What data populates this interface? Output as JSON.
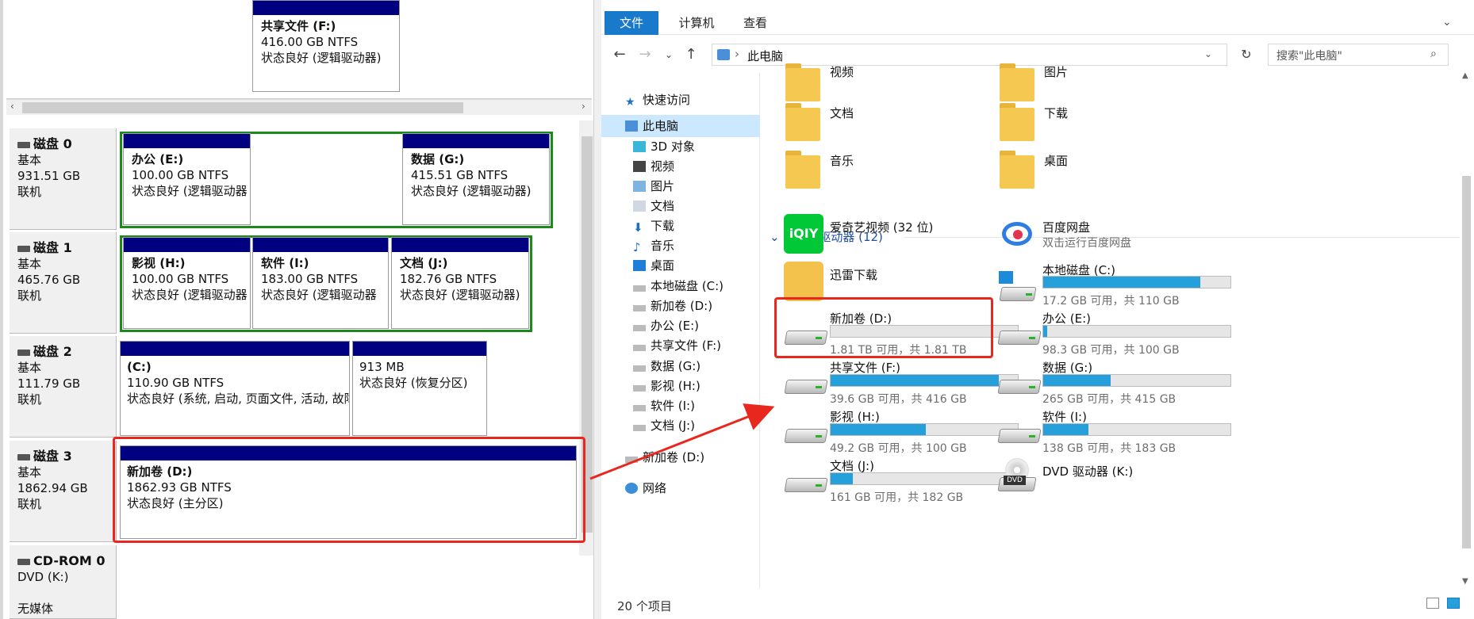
{
  "colors": {
    "accent": "#1979ca",
    "partition_header": "#000080",
    "highlight": "#e8281f",
    "usage_bar": "#26a0da",
    "group_header": "#1f4f9e"
  },
  "disk_mgmt": {
    "disks": [
      {
        "title": "磁盘 0",
        "type": "基本",
        "size": "931.51 GB",
        "state": "联机",
        "partitions": [
          {
            "name": "办公  (E:)",
            "size": "100.00 GB NTFS",
            "status": "状态良好 (逻辑驱动器"
          },
          {
            "name": "共享文件  (F:)",
            "size": "416.00 GB NTFS",
            "status": "状态良好 (逻辑驱动器)"
          },
          {
            "name": "数据  (G:)",
            "size": "415.51 GB NTFS",
            "status": "状态良好 (逻辑驱动器)"
          }
        ]
      },
      {
        "title": "磁盘 1",
        "type": "基本",
        "size": "465.76 GB",
        "state": "联机",
        "partitions": [
          {
            "name": "影视  (H:)",
            "size": "100.00 GB NTFS",
            "status": "状态良好 (逻辑驱动器"
          },
          {
            "name": "软件  (I:)",
            "size": "183.00 GB NTFS",
            "status": "状态良好 (逻辑驱动器"
          },
          {
            "name": "文档  (J:)",
            "size": "182.76 GB NTFS",
            "status": "状态良好 (逻辑驱动器)"
          }
        ]
      },
      {
        "title": "磁盘 2",
        "type": "基本",
        "size": "111.79 GB",
        "state": "联机",
        "partitions": [
          {
            "name": " (C:)",
            "size": "110.90 GB NTFS",
            "status": "状态良好 (系统, 启动, 页面文件, 活动, 故障"
          },
          {
            "name": "",
            "size": "913 MB",
            "status": "状态良好 (恢复分区)"
          }
        ]
      },
      {
        "title": "磁盘 3",
        "type": "基本",
        "size": "1862.94 GB",
        "state": "联机",
        "partitions": [
          {
            "name": "新加卷  (D:)",
            "size": "1862.93 GB NTFS",
            "status": "状态良好 (主分区)"
          }
        ]
      },
      {
        "title": "CD-ROM 0",
        "type": "DVD (K:)",
        "size": "",
        "state": "无媒体",
        "partitions": []
      }
    ]
  },
  "explorer": {
    "ribbon_tabs": [
      "文件",
      "计算机",
      "查看"
    ],
    "address": "此电脑",
    "address_arrow": "›",
    "search_placeholder": "搜索\"此电脑\"",
    "nav_items": [
      "快速访问",
      "此电脑",
      "3D 对象",
      "视频",
      "图片",
      "文档",
      "下载",
      "音乐",
      "桌面",
      "本地磁盘 (C:)",
      "新加卷 (D:)",
      "办公 (E:)",
      "共享文件 (F:)",
      "数据 (G:)",
      "影视 (H:)",
      "软件 (I:)",
      "文档 (J:)",
      "新加卷 (D:)",
      "网络"
    ],
    "folders": [
      "视频",
      "图片",
      "文档",
      "下载",
      "音乐",
      "桌面"
    ],
    "group_header": "设备和驱动器 (12)",
    "apps": [
      {
        "name": "爱奇艺视频 (32 位)",
        "sub": ""
      },
      {
        "name": "百度网盘",
        "sub": "双击运行百度网盘"
      },
      {
        "name": "迅雷下载",
        "sub": ""
      }
    ],
    "drives": [
      {
        "name": "本地磁盘 (C:)",
        "info": "17.2 GB 可用，共 110 GB",
        "used": 0.84
      },
      {
        "name": "新加卷 (D:)",
        "info": "1.81 TB 可用，共 1.81 TB",
        "used": 0.0
      },
      {
        "name": "办公 (E:)",
        "info": "98.3 GB 可用，共 100 GB",
        "used": 0.02
      },
      {
        "name": "共享文件 (F:)",
        "info": "39.6 GB 可用，共 416 GB",
        "used": 0.9
      },
      {
        "name": "数据 (G:)",
        "info": "265 GB 可用，共 415 GB",
        "used": 0.36
      },
      {
        "name": "影视 (H:)",
        "info": "49.2 GB 可用，共 100 GB",
        "used": 0.51
      },
      {
        "name": "软件 (I:)",
        "info": "138 GB 可用，共 183 GB",
        "used": 0.24
      },
      {
        "name": "文档 (J:)",
        "info": "161 GB 可用，共 182 GB",
        "used": 0.12
      },
      {
        "name": "DVD 驱动器 (K:)",
        "info": "",
        "used": null
      }
    ],
    "dvd_badge": "DVD",
    "iqiyi_logo": "iQIY",
    "status": "20 个项目"
  }
}
